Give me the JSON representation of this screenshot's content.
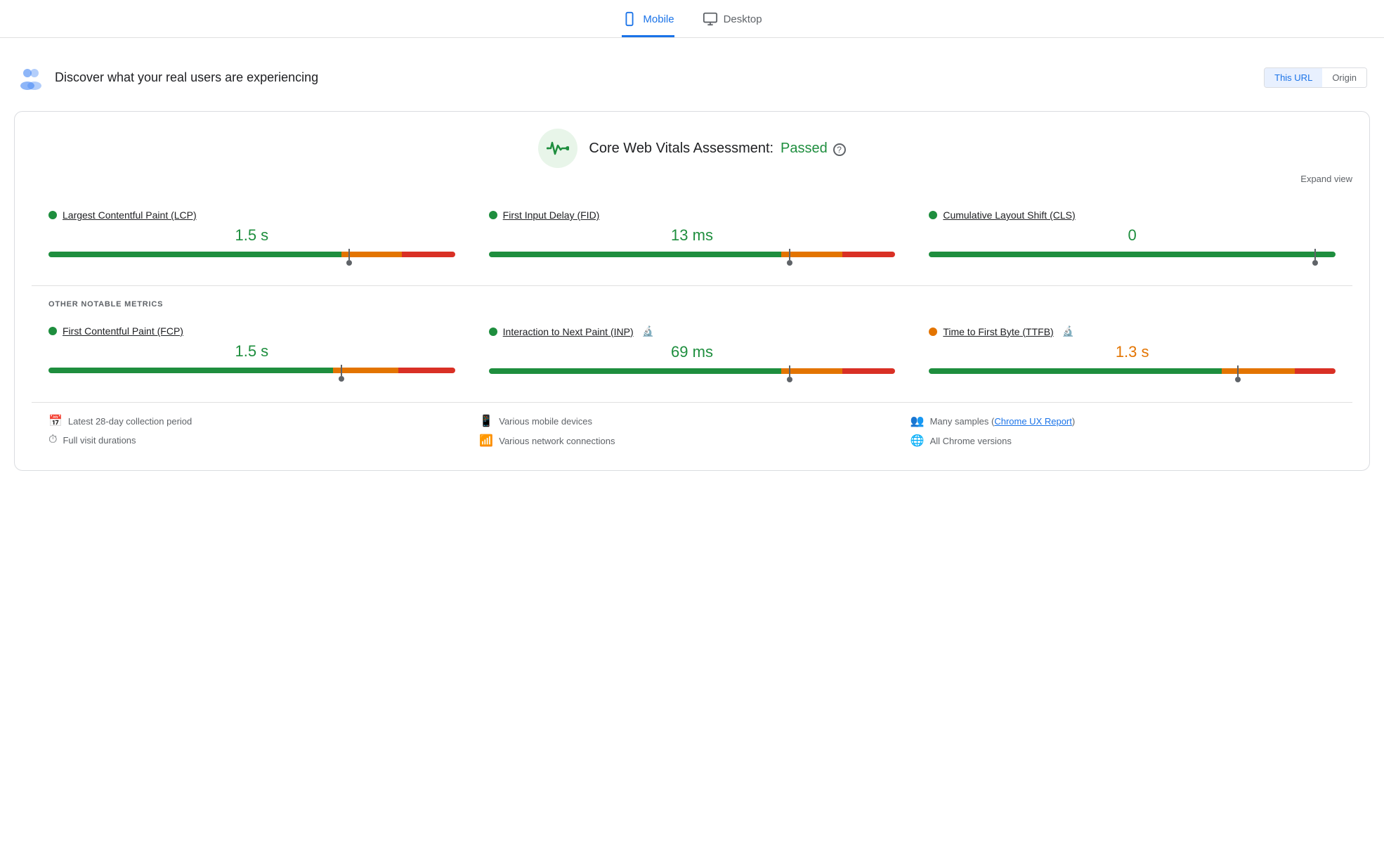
{
  "tabs": [
    {
      "id": "mobile",
      "label": "Mobile",
      "active": true
    },
    {
      "id": "desktop",
      "label": "Desktop",
      "active": false
    }
  ],
  "header": {
    "title": "Discover what your real users are experiencing",
    "this_url_label": "This URL",
    "origin_label": "Origin"
  },
  "cwv": {
    "assessment_label": "Core Web Vitals Assessment:",
    "status": "Passed",
    "help_tooltip": "?",
    "expand_label": "Expand view"
  },
  "metrics": [
    {
      "id": "lcp",
      "label": "Largest Contentful Paint (LCP)",
      "value": "1.5 s",
      "dot_color": "green",
      "bar_green_pct": 72,
      "bar_orange_pct": 15,
      "bar_red_pct": 13,
      "needle_pct": 74
    },
    {
      "id": "fid",
      "label": "First Input Delay (FID)",
      "value": "13 ms",
      "dot_color": "green",
      "bar_green_pct": 72,
      "bar_orange_pct": 15,
      "bar_red_pct": 13,
      "needle_pct": 74
    },
    {
      "id": "cls",
      "label": "Cumulative Layout Shift (CLS)",
      "value": "0",
      "dot_color": "green",
      "bar_green_pct": 100,
      "bar_orange_pct": 0,
      "bar_red_pct": 0,
      "needle_pct": 95
    }
  ],
  "other_metrics_label": "OTHER NOTABLE METRICS",
  "other_metrics": [
    {
      "id": "fcp",
      "label": "First Contentful Paint (FCP)",
      "value": "1.5 s",
      "dot_color": "green",
      "value_color": "green",
      "has_lab": false,
      "bar_green_pct": 70,
      "bar_orange_pct": 16,
      "bar_red_pct": 14,
      "needle_pct": 72
    },
    {
      "id": "inp",
      "label": "Interaction to Next Paint (INP)",
      "value": "69 ms",
      "dot_color": "green",
      "value_color": "green",
      "has_lab": true,
      "bar_green_pct": 72,
      "bar_orange_pct": 15,
      "bar_red_pct": 13,
      "needle_pct": 74
    },
    {
      "id": "ttfb",
      "label": "Time to First Byte (TTFB)",
      "value": "1.3 s",
      "dot_color": "orange",
      "value_color": "orange",
      "has_lab": true,
      "bar_green_pct": 72,
      "bar_orange_pct": 18,
      "bar_red_pct": 10,
      "needle_pct": 76
    }
  ],
  "footer": {
    "col1": [
      {
        "icon": "📅",
        "text": "Latest 28-day collection period"
      },
      {
        "icon": "⏱",
        "text": "Full visit durations"
      }
    ],
    "col2": [
      {
        "icon": "📱",
        "text": "Various mobile devices"
      },
      {
        "icon": "📶",
        "text": "Various network connections"
      }
    ],
    "col3": [
      {
        "icon": "👥",
        "text": "Many samples",
        "link": "Chrome UX Report",
        "link_text": "Chrome UX Report"
      },
      {
        "icon": "🌐",
        "text": "All Chrome versions"
      }
    ]
  }
}
